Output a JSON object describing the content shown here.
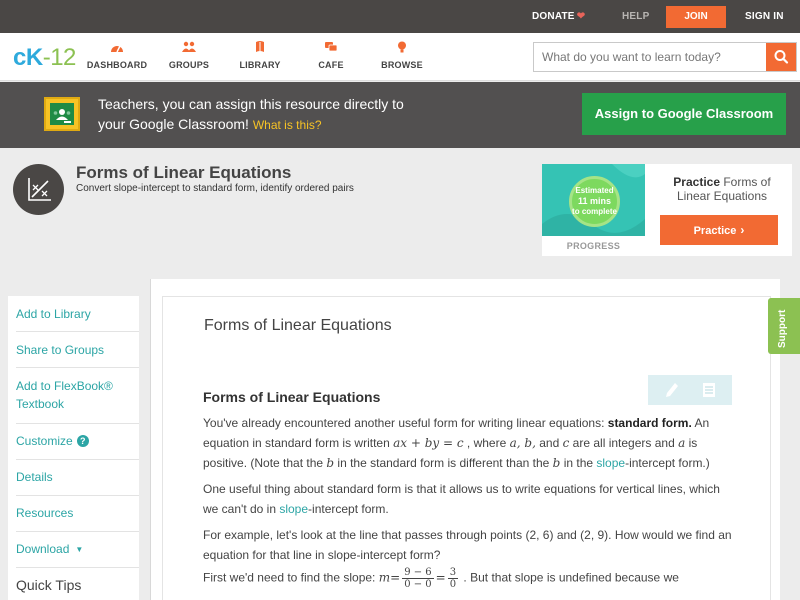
{
  "topbar": {
    "donate": "DONATE",
    "help": "HELP",
    "join": "JOIN",
    "signin": "SIGN IN"
  },
  "logo": {
    "c": "c",
    "k": "K",
    "num": "-12"
  },
  "nav": {
    "items": [
      {
        "label": "DASHBOARD",
        "icon": "dashboard-icon"
      },
      {
        "label": "GROUPS",
        "icon": "groups-icon"
      },
      {
        "label": "LIBRARY",
        "icon": "library-icon"
      },
      {
        "label": "CAFE",
        "icon": "cafe-icon"
      },
      {
        "label": "BROWSE",
        "icon": "browse-icon"
      }
    ],
    "search_placeholder": "What do you want to learn today?"
  },
  "banner": {
    "line1": "Teachers, you can assign this resource directly to",
    "line2": "your Google Classroom!",
    "what": "What is this?",
    "button": "Assign to Google Classroom"
  },
  "concept": {
    "title": "Forms of Linear Equations",
    "subtitle": "Convert slope-intercept to standard form, identify ordered pairs"
  },
  "progress": {
    "estimated": "Estimated",
    "mins": "11 mins",
    "complete": "to complete",
    "label": "PROGRESS",
    "practice_bold": "Practice",
    "practice_rest": "Forms of Linear Equations",
    "practice_button": "Practice"
  },
  "sidebar": {
    "items": [
      {
        "label": "Add to Library"
      },
      {
        "label": "Share to Groups"
      },
      {
        "label": "Add to FlexBook® Textbook"
      },
      {
        "label": "Customize"
      },
      {
        "label": "Details"
      },
      {
        "label": "Resources"
      },
      {
        "label": "Download"
      }
    ],
    "quick_tips": "Quick Tips"
  },
  "content": {
    "title": "Forms of Linear Equations",
    "section": "Forms of Linear Equations",
    "p1": {
      "a": "You've already encountered another useful form for writing linear equations: ",
      "b": "standard form.",
      "c": " An equation in standard form is written ",
      "eq": "ax + by = c",
      "d": " , where ",
      "vars": "a, b,",
      "e": " and ",
      "c_var": "c",
      "f": " are all integers and ",
      "a_var": "a",
      "g": " is positive. (Note that the ",
      "b_var": "b",
      "h": " in the standard form is different than the ",
      "b_var2": "b",
      "i": " in the ",
      "link": "slope",
      "j": "-intercept form.)"
    },
    "p2": {
      "a": "One useful thing about standard form is that it allows us to write equations for vertical lines, which we can't do in ",
      "link": "slope",
      "b": "-intercept form."
    },
    "p3": "For example, let's look at the line that passes through points (2, 6) and (2, 9). How would we find an equation for that line in slope-intercept form?",
    "p4": {
      "a": "First we'd need to find the slope: ",
      "m": "m",
      "eq1": "=",
      "f1_top": "9 − 6",
      "f1_bot": "0 − 0",
      "eq2": "=",
      "f2_top": "3",
      "f2_bot": "0",
      "b": " . But that slope is undefined because we"
    }
  },
  "support": "Support"
}
